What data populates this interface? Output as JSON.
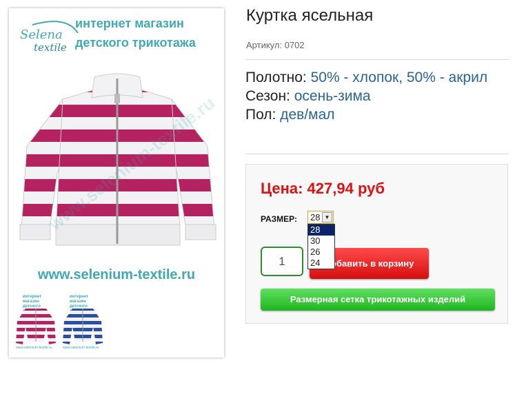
{
  "product": {
    "title": "Куртка ясельная",
    "sku": "Артикул: 0702",
    "attributes": [
      {
        "label": "Полотно: ",
        "value": "50% - хлопок, 50% - акрил"
      },
      {
        "label": "Сезон: ",
        "value": "осень-зима"
      },
      {
        "label": "Пол: ",
        "value": "дев/мал"
      }
    ]
  },
  "image": {
    "brand_name_1": "Selena",
    "brand_name_2": "textile",
    "brand_line_1": "интернет магазин",
    "brand_line_2": "детского трикотажа",
    "site_url": "www.selenium-textile.ru",
    "watermark": "www.selenium-textile.ru",
    "thumb_text_1": "интернет магазин",
    "thumb_text_2": "детского трикотажа",
    "thumb_url": "www.selenium-textile.ru"
  },
  "purchase": {
    "price": "Цена: 427,94 руб",
    "size_label": "РАЗМЕР:",
    "size_selected": "28",
    "size_options": [
      "28",
      "30",
      "26",
      "24"
    ],
    "quantity": "1",
    "cart_button": "Добавить в корзину",
    "size_chart_button": "Размерная сетка трикотажных изделий"
  },
  "colors": {
    "stripe_primary": "#b4235f",
    "stripe_alt": "#2b4fa0",
    "brand_teal": "#3fa9b6",
    "price_red": "#dd1111",
    "link_blue": "#2a6496"
  }
}
